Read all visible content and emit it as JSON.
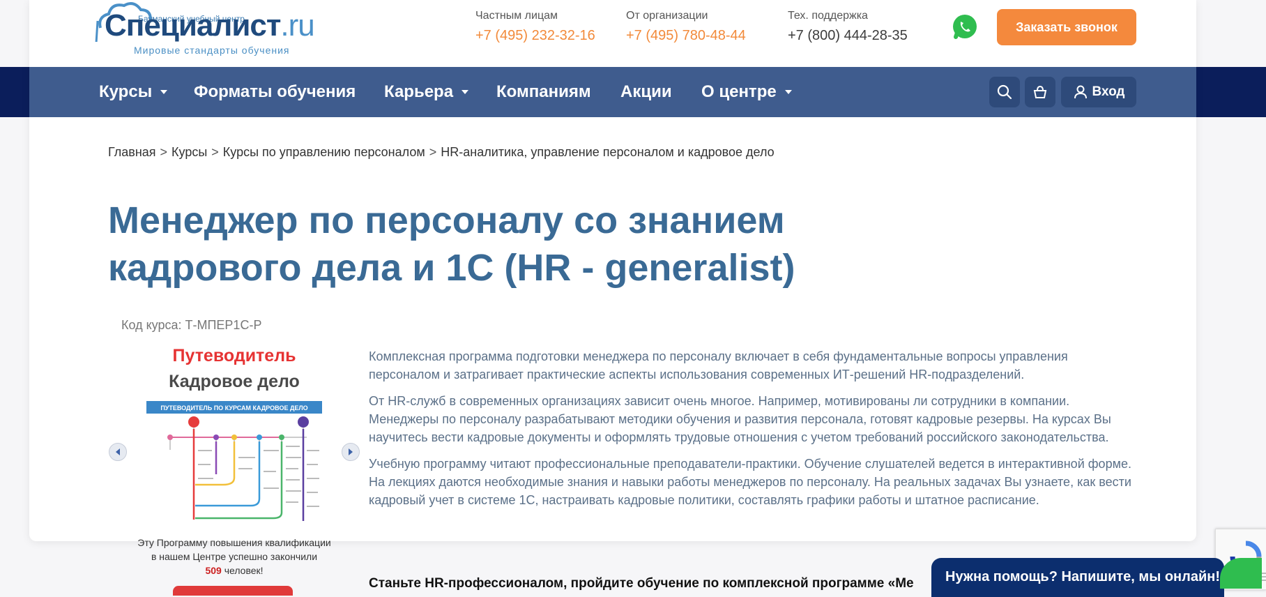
{
  "header": {
    "logo": {
      "subtitle": "Бауманский учебный центр",
      "name": "Специалист",
      "domain": ".ru",
      "tagline": "Мировые стандарты обучения"
    },
    "contacts": [
      {
        "label": "Частным лицам",
        "phone": "+7 (495) 232-32-16"
      },
      {
        "label": "От организации",
        "phone": "+7 (495) 780-48-44"
      },
      {
        "label": "Тех. поддержка",
        "phone": "+7 (800) 444-28-35"
      }
    ],
    "call_button": "Заказать звонок"
  },
  "nav": {
    "items": [
      {
        "label": "Курсы"
      },
      {
        "label": "Форматы обучения"
      },
      {
        "label": "Карьера"
      },
      {
        "label": "Компаниям"
      },
      {
        "label": "Акции"
      },
      {
        "label": "О центре"
      }
    ],
    "login_label": "Вход"
  },
  "breadcrumb": {
    "items": [
      "Главная",
      "Курсы",
      "Курсы по управлению персоналом",
      "HR-аналитика, управление персоналом и кадровое дело"
    ],
    "separator": ">"
  },
  "page": {
    "title_line1": "Менеджер по персоналу со знанием",
    "title_line2": "кадрового дела и 1С (HR - generalist)",
    "course_code": "Код курса: Т-МПЕР1С-Р"
  },
  "guide": {
    "title": "Путеводитель",
    "subtitle": "Кадровое дело",
    "image_header": "ПУТЕВОДИТЕЛЬ ПО КУРСАМ КАДРОВОЕ ДЕЛО"
  },
  "stats": {
    "line1": "Эту Программу повышения квалификации",
    "line2": "в нашем Центре успешно закончили",
    "count": "509",
    "unit": "человек!"
  },
  "description": [
    "Комплексная программа подготовки менеджера по персоналу включает в себя фундаментальные вопросы управления персоналом и затрагивает практические аспекты использования современных ИТ-решений HR-подразделений.",
    "От HR-служб в современных организациях зависит очень многое. Например, мотивированы ли сотрудники в компании. Менеджеры по персоналу разрабатывают методики обучения и развития персонала, готовят кадровые резервы. На курсах Вы научитесь вести кадровые документы и оформлять трудовые отношения с учетом требований российского законодательства.",
    "Учебную программу читают профессиональные преподаватели-практики. Обучение слушателей ведется в интерактивной форме. На лекциях даются необходимые знания и навыки работы менеджеров по персоналу. На реальных задачах Вы узнаете, как вести кадровый учет в системе 1С, настраивать кадровые политики, составлять графики работы и штатное расписание."
  ],
  "bold_line": "Станьте HR-профессионалом, пройдите обучение по комплексной программе «Ме",
  "chat": {
    "label": "Нужна помощь? Напишите, мы онлайн!"
  },
  "colors": {
    "accent_orange": "#f4893d",
    "nav_blue": "#3f5c8e",
    "title_blue": "#3a6a95",
    "navy": "#0b1e5b",
    "red": "#e63333"
  }
}
